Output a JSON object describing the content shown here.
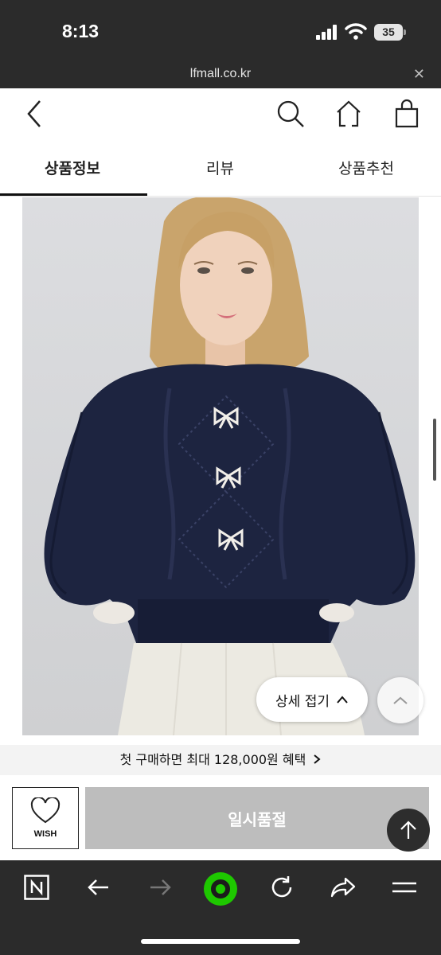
{
  "status_bar": {
    "time": "8:13",
    "battery": "35"
  },
  "url_bar": {
    "url": "lfmall.co.kr",
    "close": "✕"
  },
  "header": {
    "icons": [
      "back-icon",
      "search-icon",
      "home-icon",
      "shopping-bag-icon"
    ]
  },
  "tabs": [
    {
      "label": "상품정보",
      "active": true
    },
    {
      "label": "리뷰",
      "active": false
    },
    {
      "label": "상품추천",
      "active": false
    }
  ],
  "detail": {
    "collapse_label": "상세 접기"
  },
  "promo": {
    "text": "첫 구매하면 최대 128,000원 혜택"
  },
  "buy_bar": {
    "wish_label": "WISH",
    "soldout_label": "일시품절"
  },
  "browser_toolbar": {
    "icons": [
      "naver-n-icon",
      "back-arrow-icon",
      "forward-arrow-icon",
      "green-dot-icon",
      "refresh-icon",
      "share-icon",
      "menu-icon"
    ]
  },
  "colors": {
    "dark_bar": "#2b2b2b",
    "sweater_navy": "#1d2440",
    "soldout_gray": "#bdbdbd",
    "green": "#1ec800"
  }
}
